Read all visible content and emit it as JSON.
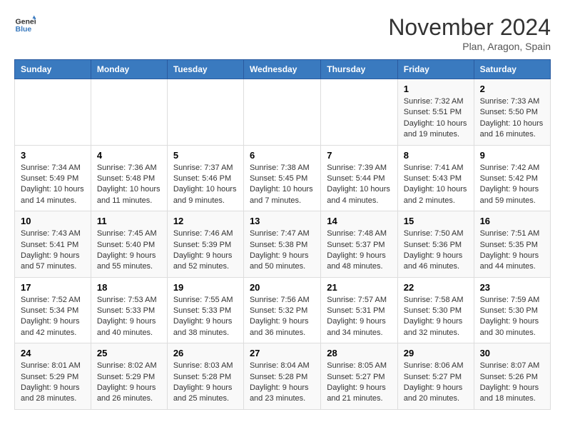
{
  "header": {
    "logo_general": "General",
    "logo_blue": "Blue",
    "month_title": "November 2024",
    "location": "Plan, Aragon, Spain"
  },
  "days_of_week": [
    "Sunday",
    "Monday",
    "Tuesday",
    "Wednesday",
    "Thursday",
    "Friday",
    "Saturday"
  ],
  "weeks": [
    [
      {
        "day": "",
        "info": ""
      },
      {
        "day": "",
        "info": ""
      },
      {
        "day": "",
        "info": ""
      },
      {
        "day": "",
        "info": ""
      },
      {
        "day": "",
        "info": ""
      },
      {
        "day": "1",
        "info": "Sunrise: 7:32 AM\nSunset: 5:51 PM\nDaylight: 10 hours and 19 minutes."
      },
      {
        "day": "2",
        "info": "Sunrise: 7:33 AM\nSunset: 5:50 PM\nDaylight: 10 hours and 16 minutes."
      }
    ],
    [
      {
        "day": "3",
        "info": "Sunrise: 7:34 AM\nSunset: 5:49 PM\nDaylight: 10 hours and 14 minutes."
      },
      {
        "day": "4",
        "info": "Sunrise: 7:36 AM\nSunset: 5:48 PM\nDaylight: 10 hours and 11 minutes."
      },
      {
        "day": "5",
        "info": "Sunrise: 7:37 AM\nSunset: 5:46 PM\nDaylight: 10 hours and 9 minutes."
      },
      {
        "day": "6",
        "info": "Sunrise: 7:38 AM\nSunset: 5:45 PM\nDaylight: 10 hours and 7 minutes."
      },
      {
        "day": "7",
        "info": "Sunrise: 7:39 AM\nSunset: 5:44 PM\nDaylight: 10 hours and 4 minutes."
      },
      {
        "day": "8",
        "info": "Sunrise: 7:41 AM\nSunset: 5:43 PM\nDaylight: 10 hours and 2 minutes."
      },
      {
        "day": "9",
        "info": "Sunrise: 7:42 AM\nSunset: 5:42 PM\nDaylight: 9 hours and 59 minutes."
      }
    ],
    [
      {
        "day": "10",
        "info": "Sunrise: 7:43 AM\nSunset: 5:41 PM\nDaylight: 9 hours and 57 minutes."
      },
      {
        "day": "11",
        "info": "Sunrise: 7:45 AM\nSunset: 5:40 PM\nDaylight: 9 hours and 55 minutes."
      },
      {
        "day": "12",
        "info": "Sunrise: 7:46 AM\nSunset: 5:39 PM\nDaylight: 9 hours and 52 minutes."
      },
      {
        "day": "13",
        "info": "Sunrise: 7:47 AM\nSunset: 5:38 PM\nDaylight: 9 hours and 50 minutes."
      },
      {
        "day": "14",
        "info": "Sunrise: 7:48 AM\nSunset: 5:37 PM\nDaylight: 9 hours and 48 minutes."
      },
      {
        "day": "15",
        "info": "Sunrise: 7:50 AM\nSunset: 5:36 PM\nDaylight: 9 hours and 46 minutes."
      },
      {
        "day": "16",
        "info": "Sunrise: 7:51 AM\nSunset: 5:35 PM\nDaylight: 9 hours and 44 minutes."
      }
    ],
    [
      {
        "day": "17",
        "info": "Sunrise: 7:52 AM\nSunset: 5:34 PM\nDaylight: 9 hours and 42 minutes."
      },
      {
        "day": "18",
        "info": "Sunrise: 7:53 AM\nSunset: 5:33 PM\nDaylight: 9 hours and 40 minutes."
      },
      {
        "day": "19",
        "info": "Sunrise: 7:55 AM\nSunset: 5:33 PM\nDaylight: 9 hours and 38 minutes."
      },
      {
        "day": "20",
        "info": "Sunrise: 7:56 AM\nSunset: 5:32 PM\nDaylight: 9 hours and 36 minutes."
      },
      {
        "day": "21",
        "info": "Sunrise: 7:57 AM\nSunset: 5:31 PM\nDaylight: 9 hours and 34 minutes."
      },
      {
        "day": "22",
        "info": "Sunrise: 7:58 AM\nSunset: 5:30 PM\nDaylight: 9 hours and 32 minutes."
      },
      {
        "day": "23",
        "info": "Sunrise: 7:59 AM\nSunset: 5:30 PM\nDaylight: 9 hours and 30 minutes."
      }
    ],
    [
      {
        "day": "24",
        "info": "Sunrise: 8:01 AM\nSunset: 5:29 PM\nDaylight: 9 hours and 28 minutes."
      },
      {
        "day": "25",
        "info": "Sunrise: 8:02 AM\nSunset: 5:29 PM\nDaylight: 9 hours and 26 minutes."
      },
      {
        "day": "26",
        "info": "Sunrise: 8:03 AM\nSunset: 5:28 PM\nDaylight: 9 hours and 25 minutes."
      },
      {
        "day": "27",
        "info": "Sunrise: 8:04 AM\nSunset: 5:28 PM\nDaylight: 9 hours and 23 minutes."
      },
      {
        "day": "28",
        "info": "Sunrise: 8:05 AM\nSunset: 5:27 PM\nDaylight: 9 hours and 21 minutes."
      },
      {
        "day": "29",
        "info": "Sunrise: 8:06 AM\nSunset: 5:27 PM\nDaylight: 9 hours and 20 minutes."
      },
      {
        "day": "30",
        "info": "Sunrise: 8:07 AM\nSunset: 5:26 PM\nDaylight: 9 hours and 18 minutes."
      }
    ]
  ]
}
